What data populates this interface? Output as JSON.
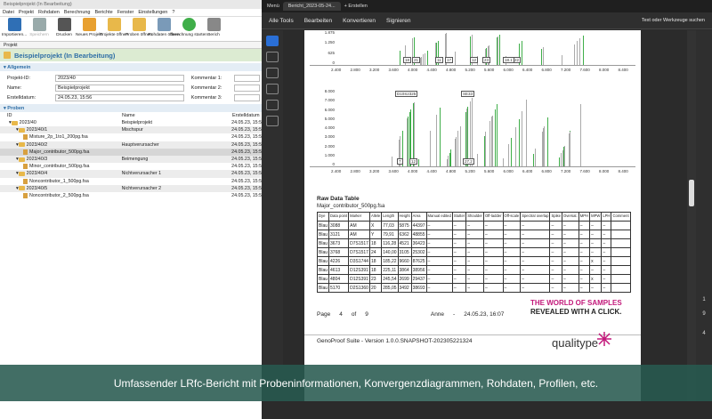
{
  "left_app": {
    "title": "Beispielprojekt (In Bearbeitung)",
    "menu": [
      "Datei",
      "Projekt",
      "Rohdaten",
      "Berechnung",
      "Berichte",
      "Fenster",
      "Einstellungen",
      "?"
    ],
    "toolbar": [
      "Importieren...",
      "Speichern",
      "Drucken",
      "Neues Projekt",
      "Projekte öffnen",
      "Proben öffnen",
      "Rohdaten öffnen",
      "Berechnung starten",
      "Berich"
    ],
    "doc_tab": "Projekt",
    "project_heading": "Beispielprojekt (In Bearbeitung)",
    "general_section": "Allgemein",
    "fields": [
      {
        "label": "Projekt-ID:",
        "value": "2023/40",
        "klabel": "Kommentar 1:"
      },
      {
        "label": "Name:",
        "value": "Beispielprojekt",
        "klabel": "Kommentar 2:"
      },
      {
        "label": "Erstelldatum:",
        "value": "24.05.23, 15:56",
        "klabel": "Kommentar 3:"
      }
    ],
    "samples_section": "Proben",
    "sample_cols": [
      "ID",
      "Name",
      "Erstelldatum"
    ],
    "samples": [
      {
        "id": "2023/40",
        "name": "Beispielprojekt",
        "date": "24.05.23, 15:5",
        "indent": 0,
        "type": "folder"
      },
      {
        "id": "2023/40/1",
        "name": "Mischspur",
        "date": "24.05.23, 15:5",
        "indent": 1,
        "type": "folder"
      },
      {
        "id": "Mixture_2p_1to1_200pg.fsa",
        "name": "",
        "date": "24.05.23, 15:5",
        "indent": 2,
        "type": "file"
      },
      {
        "id": "2023/40/2",
        "name": "Hauptverursacher",
        "date": "24.05.23, 15:5",
        "indent": 1,
        "type": "folder"
      },
      {
        "id": "Major_contributor_500pg.fsa",
        "name": "",
        "date": "24.05.23, 15:5",
        "indent": 2,
        "type": "file"
      },
      {
        "id": "2023/40/3",
        "name": "Beimengung",
        "date": "24.05.23, 15:5",
        "indent": 1,
        "type": "folder"
      },
      {
        "id": "Minor_contributor_500pg.fsa",
        "name": "",
        "date": "24.05.23, 15:5",
        "indent": 2,
        "type": "file"
      },
      {
        "id": "2023/40/4",
        "name": "Nichtverursacher 1",
        "date": "24.05.23, 15:5",
        "indent": 1,
        "type": "folder"
      },
      {
        "id": "Noncontributor_1_500pg.fsa",
        "name": "",
        "date": "24.05.23, 15:5",
        "indent": 2,
        "type": "file"
      },
      {
        "id": "2023/40/5",
        "name": "Nichtverursacher 2",
        "date": "24.05.23, 15:5",
        "indent": 1,
        "type": "folder"
      },
      {
        "id": "Noncontributor_2_500pg.fsa",
        "name": "",
        "date": "24.05.23, 15:5",
        "indent": 2,
        "type": "file"
      }
    ]
  },
  "pdf_viewer": {
    "menu_label": "Menü",
    "tab_title": "Bericht_2023-05-24...",
    "new_tab": "Erstellen",
    "menu": [
      "Alle Tools",
      "Bearbeiten",
      "Konvertieren",
      "Signieren"
    ],
    "search_placeholder": "Text oder Werkzeuge suchen",
    "page_numbers": [
      "1",
      "9",
      "4"
    ],
    "chart1_yticks": [
      "1.875",
      "1.250",
      "625",
      "0"
    ],
    "chart1_peaks": [
      "18",
      "21",
      "11",
      "17",
      "12",
      "23",
      "22",
      "18.1"
    ],
    "chart2_yticks": [
      "8.000",
      "7.000",
      "6.000",
      "5.000",
      "4.000",
      "3.000",
      "2.000",
      "1.000",
      "0"
    ],
    "chart2_labels": [
      "D10S2325",
      "SE33"
    ],
    "chart2_peaks": [
      "7",
      "12",
      "25.2",
      "27.2"
    ],
    "xticks": [
      "2.400",
      "2.800",
      "3.200",
      "3.600",
      "4.000",
      "4.400",
      "4.800",
      "5.200",
      "5.600",
      "6.000",
      "6.400",
      "6.800",
      "7.200",
      "7.600",
      "8.000",
      "8.400"
    ],
    "raw_title": "Raw Data Table",
    "raw_sub": "Major_contributor_500pg.fsa",
    "table_headers": [
      "Dye",
      "Data point",
      "Marker",
      "Allele",
      "Length",
      "Height",
      "Area",
      "Manual edited",
      "Stutter",
      "Shoulder",
      "Off-ladder",
      "Off-scale",
      "Spectral overlap",
      "Spike",
      "Oversat.",
      "MPH",
      "MPW",
      "LPH",
      "Comment"
    ],
    "table_rows": [
      [
        "Blau",
        "3088",
        "AM",
        "X",
        "77,03",
        "5875",
        "44397",
        "–",
        "–",
        "–",
        "–",
        "–",
        "–",
        "–",
        "–",
        "–",
        "–",
        "–",
        ""
      ],
      [
        "Blau",
        "3121",
        "AM",
        "Y",
        "79,91",
        "6362",
        "48855",
        "–",
        "–",
        "–",
        "–",
        "–",
        "–",
        "–",
        "–",
        "–",
        "–",
        "–",
        ""
      ],
      [
        "Blau",
        "3673",
        "D7S1517",
        "18",
        "116,28",
        "4521",
        "36423",
        "–",
        "–",
        "–",
        "–",
        "–",
        "–",
        "–",
        "–",
        "–",
        "–",
        "–",
        ""
      ],
      [
        "Blau",
        "3768",
        "D7S1517",
        "24",
        "140,00",
        "3105",
        "25302",
        "–",
        "–",
        "–",
        "–",
        "–",
        "–",
        "–",
        "–",
        "–",
        "–",
        "–",
        ""
      ],
      [
        "Blau",
        "4226",
        "D3S1744",
        "18",
        "185,22",
        "9660",
        "87625",
        "–",
        "–",
        "–",
        "–",
        "–",
        "–",
        "–",
        "–",
        "–",
        "x",
        "–",
        ""
      ],
      [
        "Blau",
        "4613",
        "D12S391",
        "18",
        "225,11",
        "3864",
        "38956",
        "–",
        "–",
        "–",
        "–",
        "–",
        "–",
        "–",
        "–",
        "–",
        "–",
        "–",
        ""
      ],
      [
        "Blau",
        "4804",
        "D12S391",
        "23",
        "245,54",
        "2699",
        "29437",
        "–",
        "–",
        "–",
        "–",
        "–",
        "–",
        "–",
        "–",
        "–",
        "x",
        "–",
        ""
      ],
      [
        "Blau",
        "5170",
        "D2S1360",
        "20",
        "285,05",
        "3492",
        "38693",
        "–",
        "–",
        "–",
        "–",
        "–",
        "–",
        "–",
        "–",
        "–",
        "–",
        "–",
        ""
      ]
    ],
    "footer_page": "Page",
    "footer_pnum": "4",
    "footer_of": "of",
    "footer_total": "9",
    "footer_user": "Anne",
    "footer_date": "24.05.23, 16:07",
    "slogan1": "THE WORLD OF SAMPLES",
    "slogan2": "REVEALED WITH A CLICK.",
    "version": "GenoProof Suite - Version 1.0.0.SNAPSHOT-202305221324",
    "logo": "qualitype"
  },
  "caption": "Umfassender LRfc-Bericht mit Probeninformationen, Konvergenzdiagrammen, Rohdaten, Profilen, etc.",
  "colors": {
    "accent_green": "#3fae49",
    "brand_magenta": "#c2187a",
    "caption_bg": "#285a50"
  }
}
